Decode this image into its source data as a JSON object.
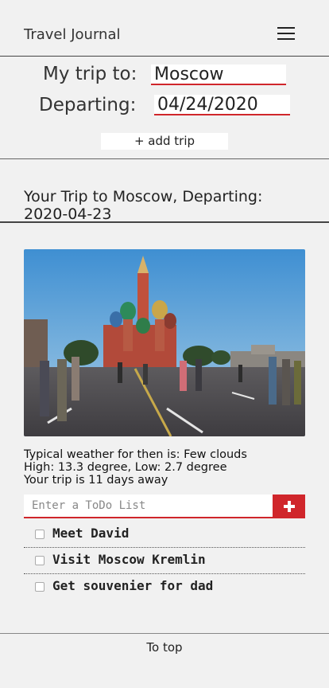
{
  "header": {
    "title": "Travel Journal",
    "menu_icon": "hamburger-icon"
  },
  "form": {
    "destination_label": "My trip to:",
    "destination_value": "Moscow",
    "departing_label": "Departing:",
    "departing_value": "04/24/2020",
    "add_trip_label": "+ add trip"
  },
  "trip": {
    "heading": "Your Trip to Moscow, Departing: 2020-04-23",
    "weather_line": "Typical weather for then is: Few clouds",
    "temp_line": "High: 13.3 degree, Low: 2.7 degree",
    "days_line": "Your trip is 11 days away"
  },
  "todo": {
    "placeholder": "Enter a ToDo List",
    "add_icon": "plus-icon",
    "items": [
      {
        "label": "Meet David",
        "checked": false
      },
      {
        "label": "Visit Moscow Kremlin",
        "checked": false
      },
      {
        "label": "Get souvenier for dad",
        "checked": false
      }
    ]
  },
  "footer": {
    "to_top_label": "To top"
  },
  "colors": {
    "accent": "#d0262b",
    "background": "#f1f1f1"
  }
}
